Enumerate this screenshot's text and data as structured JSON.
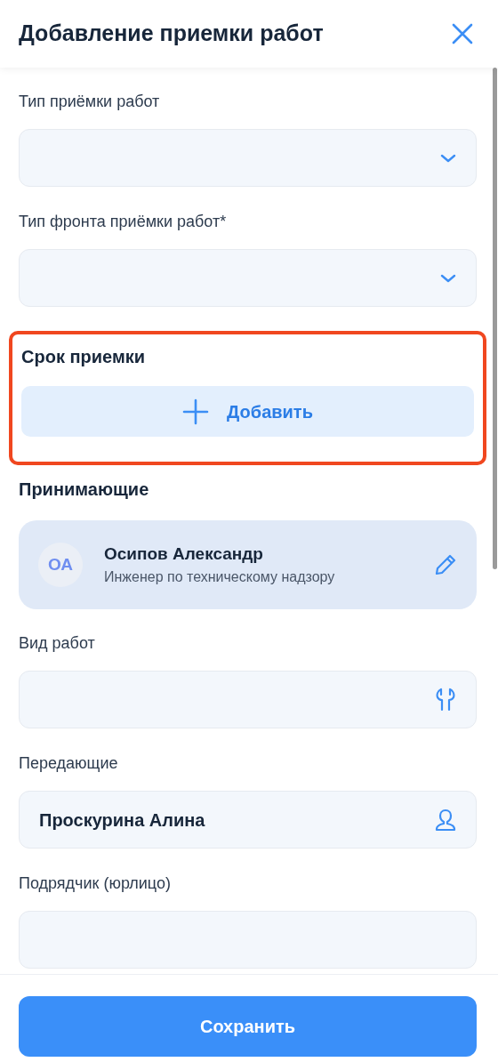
{
  "header": {
    "title": "Добавление приемки работ"
  },
  "fields": [
    {
      "kind": "select",
      "label": "Тип приёмки работ"
    },
    {
      "kind": "select",
      "label": "Тип фронта приёмки работ*"
    },
    {
      "kind": "section",
      "title": "Срок приемки",
      "button": "Добавить",
      "highlighted": true
    },
    {
      "kind": "people",
      "title": "Принимающие",
      "people": [
        {
          "initials": "ОА",
          "name": "Осипов Александр",
          "role": "Инженер по техническому надзору"
        }
      ]
    },
    {
      "kind": "tool",
      "label": "Вид работ"
    },
    {
      "kind": "person",
      "label": "Передающие",
      "value": "Проскурина Алина"
    },
    {
      "kind": "text",
      "label": "Подрядчик (юрлицо)"
    }
  ],
  "footer": {
    "button": "Сохранить"
  }
}
